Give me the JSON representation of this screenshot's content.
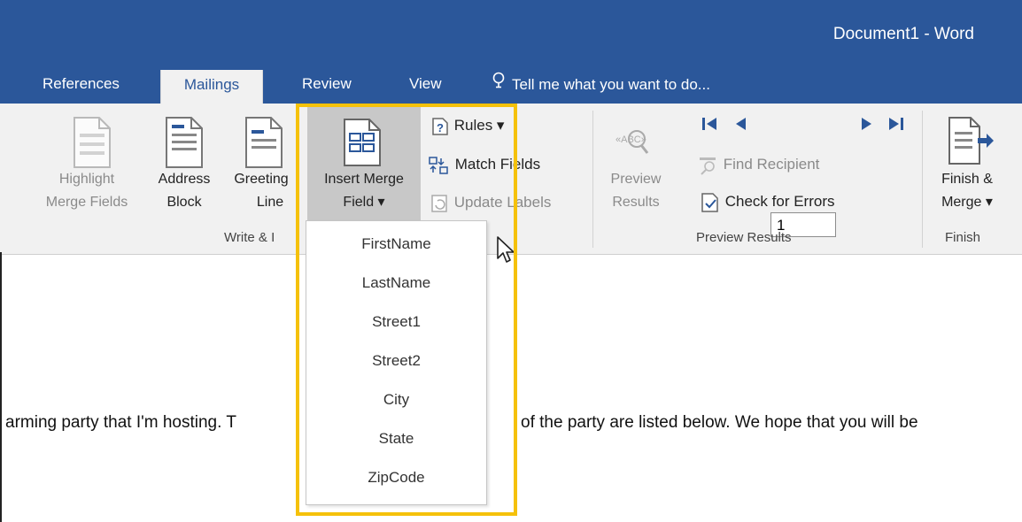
{
  "window": {
    "title": "Document1 - Word"
  },
  "tabs": [
    {
      "label": "References",
      "active": false
    },
    {
      "label": "Mailings",
      "active": true
    },
    {
      "label": "Review",
      "active": false
    },
    {
      "label": "View",
      "active": false
    }
  ],
  "tell_me": {
    "label": "Tell me what you want to do..."
  },
  "ribbon": {
    "write_insert": {
      "group_label": "Write & I",
      "highlight": {
        "line1": "Highlight",
        "line2": "Merge Fields"
      },
      "address": {
        "line1": "Address",
        "line2": "Block"
      },
      "greeting": {
        "line1": "Greeting",
        "line2": "Line"
      },
      "insert_merge": {
        "line1": "Insert Merge",
        "line2": "Field ▾"
      },
      "rules": "Rules ▾",
      "match_fields": "Match Fields",
      "update_labels": "Update Labels"
    },
    "preview_results": {
      "group_label": "Preview Results",
      "preview": {
        "line1": "Preview",
        "line2": "Results"
      },
      "record": "1",
      "find_recipient": "Find Recipient",
      "check_errors": "Check for Errors"
    },
    "finish": {
      "group_label": "Finish",
      "finish_merge": {
        "line1": "Finish &",
        "line2": "Merge ▾"
      }
    }
  },
  "merge_fields": [
    "FirstName",
    "LastName",
    "Street1",
    "Street2",
    "City",
    "State",
    "ZipCode"
  ],
  "document": {
    "text_left": "arming party that I'm hosting. T",
    "text_right": "of the party are listed below. We hope that you will be"
  },
  "colors": {
    "brand": "#2b579a",
    "highlight": "#f5c10a",
    "ribbon": "#f1f1f1"
  }
}
